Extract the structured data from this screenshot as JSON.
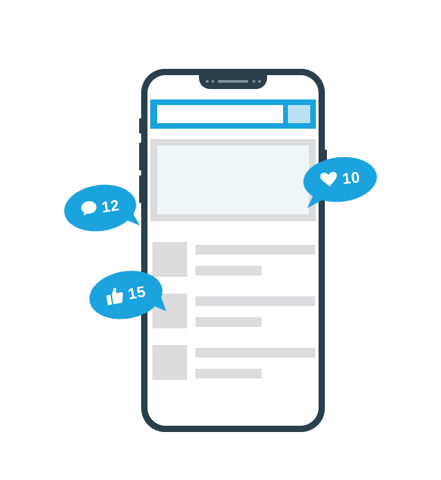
{
  "notifications": {
    "comments": {
      "count": "12",
      "icon": "comment-icon"
    },
    "hearts": {
      "count": "10",
      "icon": "heart-icon"
    },
    "likes": {
      "count": "15",
      "icon": "thumbs-up-icon"
    }
  },
  "colors": {
    "accent": "#1aa3dd",
    "phone_body": "#2a3f4b",
    "placeholder": "#dcdcdf",
    "search_button": "#b9e0f3"
  }
}
